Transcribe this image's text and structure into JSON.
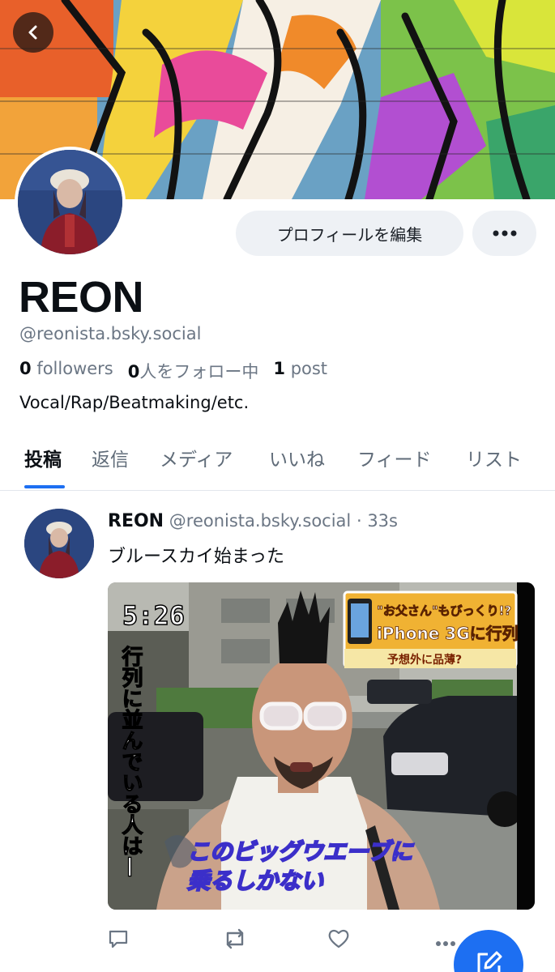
{
  "profile": {
    "display_name": "REON",
    "handle": "@reonista.bsky.social",
    "followers_count": "0",
    "followers_label": "followers",
    "following_count": "0",
    "following_label": "人をフォロー中",
    "posts_count": "1",
    "posts_label": "post",
    "bio": "Vocal/Rap/Beatmaking/etc."
  },
  "header": {
    "edit_profile_label": "プロフィールを編集"
  },
  "tabs": [
    {
      "label": "投稿",
      "active": true
    },
    {
      "label": "返信",
      "active": false
    },
    {
      "label": "メディア",
      "active": false
    },
    {
      "label": "いいね",
      "active": false
    },
    {
      "label": "フィード",
      "active": false
    },
    {
      "label": "リスト",
      "active": false
    }
  ],
  "post": {
    "author": "REON",
    "handle": "@reonista.bsky.social",
    "separator": "·",
    "time": "33s",
    "text": "ブルースカイ始まった",
    "image": {
      "clock": "5:26",
      "banner_line1": "\"お父さん\"もびっくり!?",
      "banner_line2": "iPhone 3Gに行列",
      "banner_line3": "予想外に品薄?",
      "vertical_caption": "行列に並んでいる人は—",
      "subtitle_line1": "このビッグウエーブに",
      "subtitle_line2": "乗るしかない"
    }
  },
  "icons": {
    "back": "chevron-left-icon",
    "more": "ellipsis-icon",
    "reply": "comment-icon",
    "repost": "repost-icon",
    "like": "heart-icon",
    "post_more": "ellipsis-icon",
    "compose": "compose-icon"
  },
  "colors": {
    "accent": "#1d6ff2",
    "muted_text": "#6b7684",
    "button_bg": "#eef1f5"
  }
}
